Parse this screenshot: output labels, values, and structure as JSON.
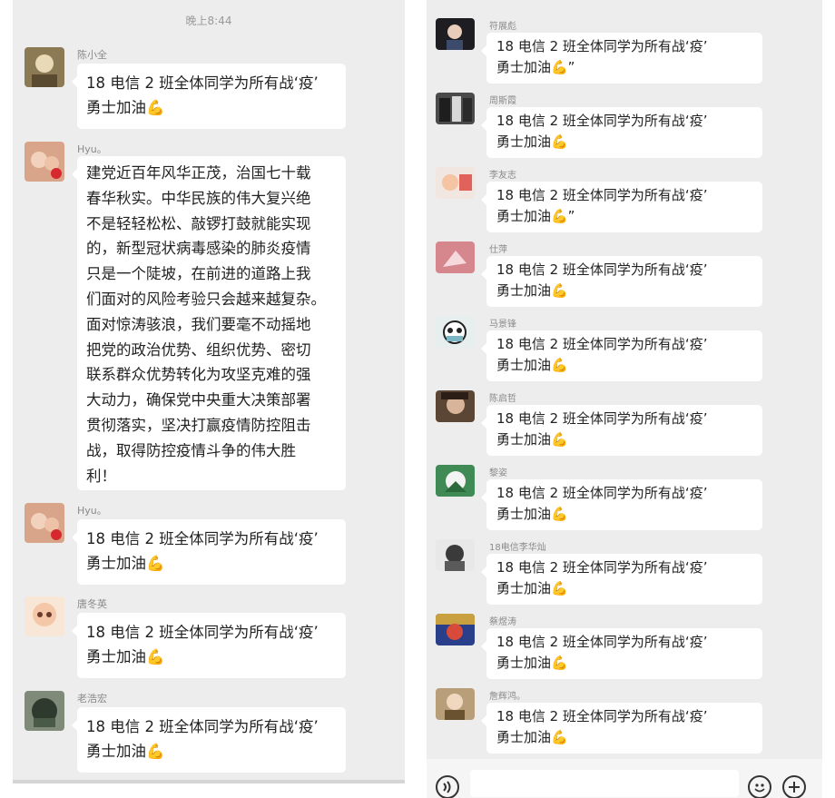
{
  "time_label": "晚上8:44",
  "cheer_text": "18 电信 2 班全体同学为所有战‘疫’\n勇士加油💪",
  "left_messages": [
    {
      "name": "陈小全",
      "text": "18 电信 2 班全体同学为所有战‘疫’\n勇士加油💪"
    },
    {
      "name": "Hyu。",
      "text": "建党近百年风华正茂，治国七十载\n春华秋实。中华民族的伟大复兴绝\n不是轻轻松松、敲锣打鼓就能实现\n的，新型冠状病毒感染的肺炎疫情\n只是一个陡坡，在前进的道路上我\n们面对的风险考验只会越来越复杂。\n面对惊涛骇浪，我们要毫不动摇地\n把党的政治优势、组织优势、密切\n联系群众优势转化为攻坚克难的强\n大动力，确保党中央重大决策部署\n贯彻落实，坚决打赢疫情防控阻击\n战，取得防控疫情斗争的伟大胜\n利！"
    },
    {
      "name": "Hyu。",
      "text": "18 电信 2 班全体同学为所有战‘疫’\n勇士加油💪"
    },
    {
      "name": "唐冬英",
      "text": "18 电信 2 班全体同学为所有战‘疫’\n勇士加油💪"
    },
    {
      "name": "老浩宏",
      "text": "18 电信 2 班全体同学为所有战‘疫’\n勇士加油💪"
    }
  ],
  "right_messages": [
    {
      "name": "符展彪",
      "text": "18 电信 2 班全体同学为所有战‘疫’\n勇士加油💪”"
    },
    {
      "name": "周斯霞",
      "text": "18 电信 2 班全体同学为所有战‘疫’\n勇士加油💪"
    },
    {
      "name": "李友志",
      "text": "18 电信 2 班全体同学为所有战‘疫’\n勇士加油💪”"
    },
    {
      "name": "仕萍",
      "text": "18 电信 2 班全体同学为所有战‘疫’\n勇士加油💪"
    },
    {
      "name": "马景锋",
      "text": "18 电信 2 班全体同学为所有战‘疫’\n勇士加油💪"
    },
    {
      "name": "陈启哲",
      "text": "18 电信 2 班全体同学为所有战‘疫’\n勇士加油💪"
    },
    {
      "name": "黎姿",
      "text": "18 电信 2 班全体同学为所有战‘疫’\n勇士加油💪"
    },
    {
      "name": "18电信李华灿",
      "text": "18 电信 2 班全体同学为所有战‘疫’\n勇士加油💪"
    },
    {
      "name": "蔡煜涛",
      "text": "18 电信 2 班全体同学为所有战‘疫’\n勇士加油💪"
    },
    {
      "name": "詹辉鸿。",
      "text": "18 电信 2 班全体同学为所有战‘疫’\n勇士加油💪"
    }
  ],
  "avatar_colors": {
    "left": [
      "#6b5a3c",
      "#c8866a",
      "#c8866a",
      "#f3c7a8",
      "#3f4a3a"
    ],
    "right": [
      "#2a2a2a",
      "#3b3b3b",
      "#e8d0c4",
      "#c9848a",
      "#b7c9c9",
      "#6d5a4a",
      "#4f8a5a",
      "#4a4a4a",
      "#8a6a3a",
      "#9a8060"
    ]
  },
  "icons": {
    "voice": "voice-icon",
    "emoji": "emoji-icon",
    "add": "add-icon"
  }
}
